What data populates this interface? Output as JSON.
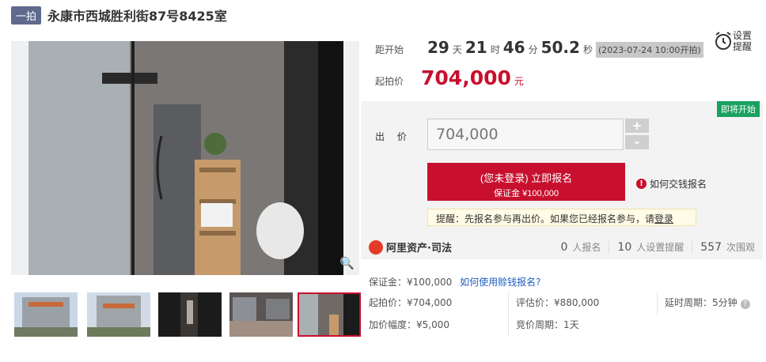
{
  "title": {
    "badge": "一拍",
    "text": "永康市西城胜利街87号8425室"
  },
  "gallery": {
    "zoom_icon": "search-icon",
    "thumbnail_count": 5,
    "selected_index": 4
  },
  "countdown": {
    "label": "距开始",
    "days": "29",
    "days_unit": "天",
    "hours": "21",
    "hours_unit": "时",
    "minutes": "46",
    "minutes_unit": "分",
    "seconds": "50.2",
    "seconds_unit": "秒",
    "start_time": "(2023-07-24 10:00开拍)"
  },
  "reminder": {
    "label": "设置提醒",
    "icon": "alarm-clock-icon"
  },
  "start_price": {
    "label": "起拍价",
    "value": "704,000",
    "unit": "元"
  },
  "bid": {
    "status_badge": "即将开始",
    "label": "出 价",
    "input_value": "704,000",
    "plus": "+",
    "minus": "-",
    "register_main": "(您未登录) 立即报名",
    "register_sub": "保证金 ¥100,000",
    "howto_icon": "!",
    "howto": "如何交钱报名",
    "tip_text": "提醒：先报名参与再出价。如果您已经报名参与，请",
    "tip_link": "登录"
  },
  "stats": {
    "logo_text": "阿里资产·司法",
    "registered": "0",
    "registered_label": "人报名",
    "reminders": "10",
    "reminders_label": "人设置提醒",
    "views": "557",
    "views_label": "次围观"
  },
  "details": {
    "deposit": "保证金：¥100,000",
    "deposit_link": "如何使用赊钱报名?",
    "start_price": "起拍价：¥704,000",
    "appraisal": "评估价：¥880,000",
    "delay": "延时周期：5分钟",
    "help_icon": "?",
    "increment": "加价幅度：¥5,000",
    "bid_cycle": "竞价周期：1天"
  },
  "colors": {
    "accent": "#c8102e",
    "badge": "#5f6a8c",
    "status_green": "#19a15f",
    "link": "#1f5fbf"
  }
}
